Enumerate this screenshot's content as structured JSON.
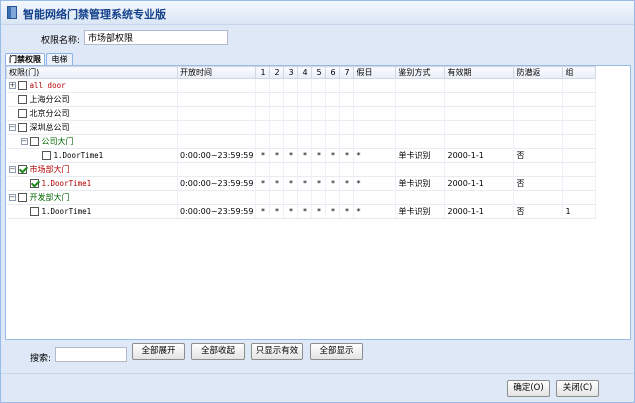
{
  "window": {
    "title": "智能网络门禁管理系统专业版"
  },
  "permission": {
    "label": "权限名称:",
    "value": "市场部权限"
  },
  "tabs": [
    {
      "label": "门禁权限"
    },
    {
      "label": "电梯"
    }
  ],
  "grid": {
    "columns": [
      "权限(门)",
      "开放时间",
      "1",
      "2",
      "3",
      "4",
      "5",
      "6",
      "7",
      "假日",
      "鉴别方式",
      "有效期",
      "防潜返",
      "组"
    ],
    "rows": [
      {
        "name": "all door",
        "style": "red mono",
        "depth": 0,
        "expander": "+",
        "checked": false,
        "leaf": false
      },
      {
        "name": "上海分公司",
        "style": "",
        "depth": 0,
        "expander": "",
        "checked": false,
        "leaf": false
      },
      {
        "name": "北京分公司",
        "style": "",
        "depth": 0,
        "expander": "",
        "checked": false,
        "leaf": false
      },
      {
        "name": "深圳总公司",
        "style": "",
        "depth": 0,
        "expander": "−",
        "checked": false,
        "leaf": false
      },
      {
        "name": "公司大门",
        "style": "green",
        "depth": 1,
        "expander": "−",
        "checked": false,
        "leaf": false
      },
      {
        "name": "1.DoorTime1",
        "style": "mono",
        "depth": 2,
        "expander": "",
        "checked": false,
        "leaf": true,
        "time": "0:00:00~23:59:59",
        "d1": "*",
        "d2": "*",
        "d3": "*",
        "d4": "*",
        "d5": "*",
        "d6": "*",
        "d7": "*",
        "holiday": "*",
        "auth": "单卡识别",
        "valid": "2000-1-1",
        "antipass": "否",
        "group": ""
      },
      {
        "name": "市场部大门",
        "style": "red",
        "depth": 0,
        "expander": "−",
        "checked": true,
        "leaf": false
      },
      {
        "name": "1.DoorTime1",
        "style": "red mono",
        "depth": 1,
        "expander": "",
        "checked": true,
        "leaf": true,
        "time": "0:00:00~23:59:59",
        "d1": "*",
        "d2": "*",
        "d3": "*",
        "d4": "*",
        "d5": "*",
        "d6": "*",
        "d7": "*",
        "holiday": "*",
        "auth": "单卡识别",
        "valid": "2000-1-1",
        "antipass": "否",
        "group": ""
      },
      {
        "name": "开发部大门",
        "style": "green",
        "depth": 0,
        "expander": "−",
        "checked": false,
        "leaf": false
      },
      {
        "name": "1.DoorTime1",
        "style": "mono",
        "depth": 1,
        "expander": "",
        "checked": false,
        "leaf": true,
        "time": "0:00:00~23:59:59",
        "d1": "*",
        "d2": "*",
        "d3": "*",
        "d4": "*",
        "d5": "*",
        "d6": "*",
        "d7": "*",
        "holiday": "*",
        "auth": "单卡识别",
        "valid": "2000-1-1",
        "antipass": "否",
        "group": "1"
      }
    ]
  },
  "search": {
    "label": "搜索:",
    "value": ""
  },
  "actions": {
    "expand_all": "全部展开",
    "collapse_all": "全部收起",
    "show_valid": "只显示有效",
    "show_all": "全部显示"
  },
  "footer": {
    "ok": "确定(O)",
    "close": "关闭(C)"
  },
  "colors": {
    "accent": "#15428b",
    "frame": "#dfe8f6",
    "border": "#99bbe8"
  }
}
